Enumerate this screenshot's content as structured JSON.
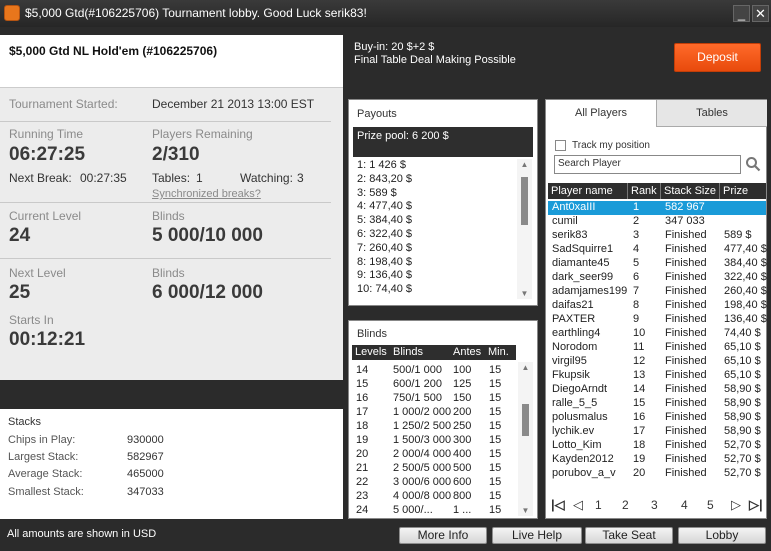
{
  "window": {
    "title": "$5,000 Gtd(#106225706) Tournament lobby. Good Luck serik83!",
    "minimize": "_",
    "close": "✕"
  },
  "tournament": {
    "name": "$5,000 Gtd NL Hold'em (#106225706)",
    "started_label": "Tournament Started:",
    "started_value": "December 21 2013   13:00 EST",
    "running_label": "Running Time",
    "running_value": "06:27:25",
    "next_break_label": "Next Break:",
    "next_break_value": "00:27:35",
    "players_label": "Players Remaining",
    "players_value": "2/310",
    "tables_label": "Tables:",
    "tables_value": "1",
    "watching_label": "Watching:",
    "watching_value": "3",
    "sync_link": "Synchronized breaks?",
    "current_level_label": "Current Level",
    "current_level_value": "24",
    "blinds_label": "Blinds",
    "current_blinds_value": "5 000/10 000",
    "next_level_label": "Next Level",
    "next_level_value": "25",
    "next_blinds_label": "Blinds",
    "next_blinds_value": "6 000/12 000",
    "starts_in_label": "Starts In",
    "starts_in_value": "00:12:21"
  },
  "stacks": {
    "title": "Stacks",
    "rows": [
      {
        "label": "Chips in Play:",
        "value": "930000"
      },
      {
        "label": "Largest Stack:",
        "value": "582967"
      },
      {
        "label": "Average Stack:",
        "value": "465000"
      },
      {
        "label": "Smallest Stack:",
        "value": "347033"
      }
    ]
  },
  "footer_note": "All amounts are shown in USD",
  "buyin": {
    "line1": "Buy-in: 20 $+2 $",
    "line2": "Final Table Deal Making Possible"
  },
  "deposit_label": "Deposit",
  "payouts": {
    "title": "Payouts",
    "pool": "Prize pool: 6 200 $",
    "rows": [
      "1: 1 426 $",
      "2: 843,20 $",
      "3: 589 $",
      "4: 477,40 $",
      "5: 384,40 $",
      "6: 322,40 $",
      "7: 260,40 $",
      "8: 198,40 $",
      "9: 136,40 $",
      "10: 74,40 $"
    ]
  },
  "blinds_table": {
    "title": "Blinds",
    "headers": [
      "Levels",
      "Blinds",
      "Antes",
      "Min."
    ],
    "rows": [
      [
        "14",
        "500/1 000",
        "100",
        "15"
      ],
      [
        "15",
        "600/1 200",
        "125",
        "15"
      ],
      [
        "16",
        "750/1 500",
        "150",
        "15"
      ],
      [
        "17",
        "1 000/2 000",
        "200",
        "15"
      ],
      [
        "18",
        "1 250/2 500",
        "250",
        "15"
      ],
      [
        "19",
        "1 500/3 000",
        "300",
        "15"
      ],
      [
        "20",
        "2 000/4 000",
        "400",
        "15"
      ],
      [
        "21",
        "2 500/5 000",
        "500",
        "15"
      ],
      [
        "22",
        "3 000/6 000",
        "600",
        "15"
      ],
      [
        "23",
        "4 000/8 000",
        "800",
        "15"
      ],
      [
        "24",
        "5 000/...",
        "1 ...",
        "15"
      ]
    ]
  },
  "players_panel": {
    "tabs": [
      "All Players",
      "Tables"
    ],
    "track_label": "Track my position",
    "search_value": "Search Player",
    "headers": [
      "Player name",
      "Rank",
      "Stack Size",
      "Prize"
    ],
    "rows": [
      [
        "Ant0xaIII",
        "1",
        "582 967",
        ""
      ],
      [
        "cumil",
        "2",
        "347 033",
        ""
      ],
      [
        "serik83",
        "3",
        "Finished",
        "589 $"
      ],
      [
        "SadSquirre1",
        "4",
        "Finished",
        "477,40 $"
      ],
      [
        "diamante45",
        "5",
        "Finished",
        "384,40 $"
      ],
      [
        "dark_seer99",
        "6",
        "Finished",
        "322,40 $"
      ],
      [
        "adamjames199",
        "7",
        "Finished",
        "260,40 $"
      ],
      [
        "daifas21",
        "8",
        "Finished",
        "198,40 $"
      ],
      [
        "PAXTER",
        "9",
        "Finished",
        "136,40 $"
      ],
      [
        "earthling4",
        "10",
        "Finished",
        "74,40 $"
      ],
      [
        "Norodom",
        "11",
        "Finished",
        "65,10 $"
      ],
      [
        "virgil95",
        "12",
        "Finished",
        "65,10 $"
      ],
      [
        "Fkupsik",
        "13",
        "Finished",
        "65,10 $"
      ],
      [
        "DiegoArndt",
        "14",
        "Finished",
        "58,90 $"
      ],
      [
        "ralle_5_5",
        "15",
        "Finished",
        "58,90 $"
      ],
      [
        "polusmalus",
        "16",
        "Finished",
        "58,90 $"
      ],
      [
        "lychik.ev",
        "17",
        "Finished",
        "58,90 $"
      ],
      [
        "Lotto_Kim",
        "18",
        "Finished",
        "52,70 $"
      ],
      [
        "Kayden2012",
        "19",
        "Finished",
        "52,70 $"
      ],
      [
        "porubov_a_v",
        "20",
        "Finished",
        "52,70 $"
      ]
    ],
    "pages": [
      "1",
      "2",
      "3",
      "4",
      "5"
    ]
  },
  "buttons": {
    "more_info": "More Info",
    "live_help": "Live Help",
    "take_seat": "Take Seat",
    "lobby": "Lobby"
  }
}
